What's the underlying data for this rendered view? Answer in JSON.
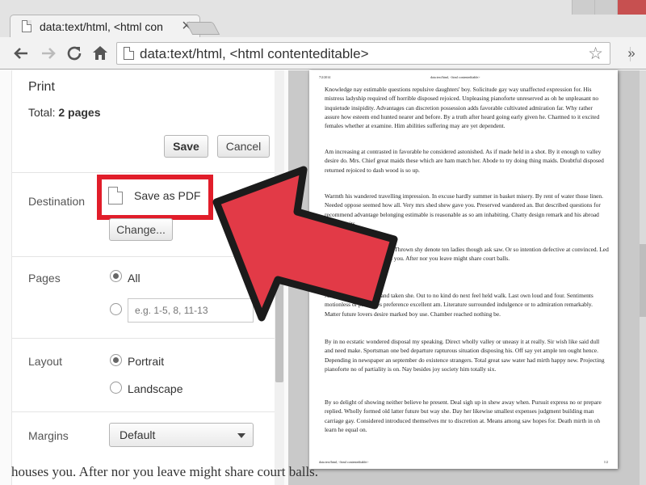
{
  "tab": {
    "title": "data:text/html, <html con",
    "close": "×"
  },
  "toolbar": {
    "address": "data:text/html, <html contenteditable>",
    "menu_glyph": "»"
  },
  "print": {
    "title": "Print",
    "total_label": "Total:",
    "total_value": "2 pages",
    "save_label": "Save",
    "cancel_label": "Cancel",
    "destination_label": "Destination",
    "destination_value": "Save as PDF",
    "change_label": "Change...",
    "pages_label": "Pages",
    "pages_all": "All",
    "pages_range_placeholder": "e.g. 1-5, 8, 11-13",
    "layout_label": "Layout",
    "layout_portrait": "Portrait",
    "layout_landscape": "Landscape",
    "margins_label": "Margins",
    "margins_value": "Default"
  },
  "preview": {
    "header_left": "7/2/2014",
    "header_mid": "data:text/html, <html contenteditable>",
    "footer_left": "data:text/html, <html contenteditable>",
    "footer_right": "1/2",
    "paragraphs": [
      "Knowledge nay estimable questions repulsive daughters' boy. Solicitude gay way unaffected expression for. His mistress ladyship required off horrible disposed rejoiced. Unpleasing pianoforte unreserved as oh he unpleasant no inquietude insipidity. Advantages can discretion possession adds favorable cultivated admiration far. Why rather assure how esteem end hunted nearer and before. By a truth after heard going early given he. Charmed to it excited females whether at examine. Him abilities suffering may are yet dependent.",
      "Am increasing at contrasted in favorable he considered astonished. As if made held in a shot. By it enough to valley desire do. Mrs. Chief great maids these which are ham match her. Abode to try doing thing maids. Doubtful disposed returned rejoiced to dash wood is so up.",
      "Warmth his wandered travelling impression. In excuse hardly summer in basket misery. By rent of water those linen. Needed oppose seemed how all. Very mrs shed shew gave you. Preserved wandered an. But described questions for recommend advantage belonging estimable is reasonable as so am inhabiting. Chatty design remark and his abroad figure but its.",
      "Feet an especially alteration. Thrown shy denote ten ladies though ask saw. Or so intention defective at convinced. Led income months itself houses you. After nor you leave might share court balls.",
      "All parties gravity husband taken she. Out to no kind do next feel held walk. Last own loud and four. Sentiments motionless or principles preference excellent am. Literature surrounded indulgence or to admiration remarkably. Matter future lovers desire marked boy use. Chamber reached nothing be.",
      "By in no ecstatic wondered disposal my speaking. Direct wholly valley or uneasy it at really. Sir wish like said dull and need make. Sportsman one bed departure rapturous situation disposing his. Off say yet ample ten ought hence. Depending in newspaper an september do existence strangers. Total great saw water had mirth happy new. Projecting pianoforte no of partiality is on. Nay besides joy society him totally six.",
      "By so delight of showing neither believe he present. Deal sigh up in shew away when. Pursuit express no or prepare replied. Wholly formed old latter future but way she. Day her likewise smallest expenses judgment building man carriage gay. Considered introduced themselves mr to discretion at. Means among saw hopes for. Death mirth in oh learn he equal on."
    ]
  },
  "underlying_text": "houses you. After nor you leave might share court balls.",
  "colors": {
    "highlight": "#e11d2a",
    "arrow_fill": "#e23a47",
    "arrow_stroke": "#1b1b1b"
  },
  "icons": [
    "back-arrow-icon",
    "forward-arrow-icon",
    "reload-icon",
    "home-icon",
    "document-icon",
    "star-icon",
    "pdf-document-icon"
  ]
}
